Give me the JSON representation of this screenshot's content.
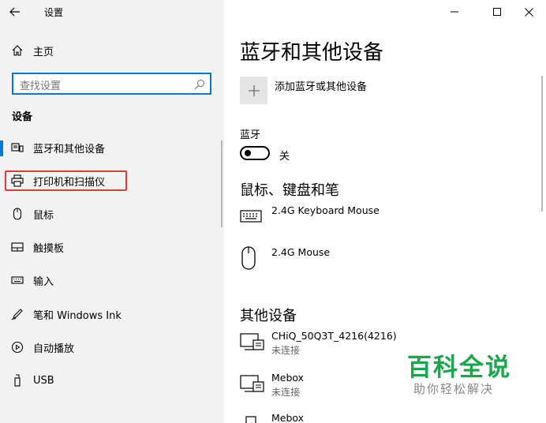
{
  "window": {
    "title": "设置",
    "controls": {
      "minimize": "minimize-icon",
      "maximize": "maximize-icon",
      "close": "close-icon"
    }
  },
  "sidebar": {
    "home_label": "主页",
    "search_placeholder": "查找设置",
    "section_header": "设备",
    "items": [
      {
        "label": "蓝牙和其他设备",
        "icon": "bluetooth-devices-icon",
        "selected": true
      },
      {
        "label": "打印机和扫描仪",
        "icon": "printer-icon",
        "highlighted": true
      },
      {
        "label": "鼠标",
        "icon": "mouse-icon"
      },
      {
        "label": "触摸板",
        "icon": "touchpad-icon"
      },
      {
        "label": "输入",
        "icon": "keyboard-icon"
      },
      {
        "label": "笔和 Windows Ink",
        "icon": "pen-icon"
      },
      {
        "label": "自动播放",
        "icon": "autoplay-icon"
      },
      {
        "label": "USB",
        "icon": "usb-icon"
      }
    ]
  },
  "main": {
    "title": "蓝牙和其他设备",
    "add_device_label": "添加蓝牙或其他设备",
    "bluetooth": {
      "label": "蓝牙",
      "toggle_state": "关",
      "on": false
    },
    "mouse_keyboard_section": {
      "title": "鼠标、键盘和笔",
      "devices": [
        {
          "name": "2.4G Keyboard Mouse",
          "icon": "keyboard-icon"
        },
        {
          "name": "2.4G Mouse",
          "icon": "mouse-icon"
        }
      ]
    },
    "other_devices_section": {
      "title": "其他设备",
      "devices": [
        {
          "name": "CHiQ_50Q3T_4216(4216)",
          "status": "未连接",
          "icon": "display-device-icon"
        },
        {
          "name": "Mebox",
          "status": "未连接",
          "icon": "display-device-icon"
        },
        {
          "name": "Mebox",
          "icon": "media-device-icon"
        }
      ]
    }
  },
  "watermark": {
    "title": "百科全说",
    "subtitle": "助你轻松解决"
  },
  "colors": {
    "accent": "#0078d7",
    "highlight_box": "#e23a3a",
    "watermark_green": "#1aa64a",
    "sidebar_bg": "#f2f2f2"
  }
}
